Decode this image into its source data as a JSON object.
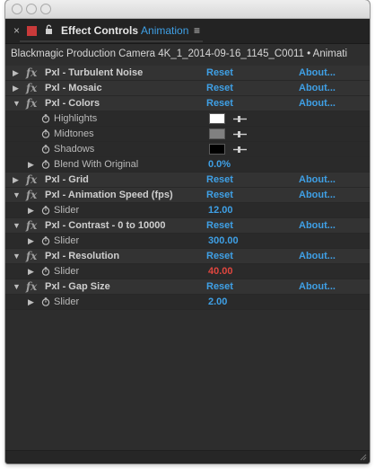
{
  "window": {
    "tab": {
      "close_glyph": "×",
      "label": "Effect Controls",
      "comp_name": "Animation",
      "menu_glyph": "≡",
      "swatch_color": "#c93a3a"
    },
    "clip_title": "Blackmagic Production Camera 4K_1_2014-09-16_1145_C0011 • Animati",
    "accent_color": "#3fa0e6",
    "error_color": "#e0463f"
  },
  "rows": [
    {
      "kind": "effect",
      "expanded": false,
      "name": "Pxl - Turbulent Noise",
      "reset": "Reset",
      "about": "About..."
    },
    {
      "kind": "effect",
      "expanded": false,
      "name": "Pxl - Mosaic",
      "reset": "Reset",
      "about": "About..."
    },
    {
      "kind": "effect",
      "expanded": true,
      "name": "Pxl - Colors",
      "reset": "Reset",
      "about": "About..."
    },
    {
      "kind": "color",
      "name": "Highlights",
      "color": "#ffffff"
    },
    {
      "kind": "color",
      "name": "Midtones",
      "color": "#808080"
    },
    {
      "kind": "color",
      "name": "Shadows",
      "color": "#000000"
    },
    {
      "kind": "param",
      "expanded": false,
      "name": "Blend With Original",
      "value": "0.0%",
      "red": false
    },
    {
      "kind": "effect",
      "expanded": false,
      "name": "Pxl - Grid",
      "reset": "Reset",
      "about": "About..."
    },
    {
      "kind": "effect",
      "expanded": true,
      "name": "Pxl - Animation Speed (fps)",
      "reset": "Reset",
      "about": "About..."
    },
    {
      "kind": "param",
      "expanded": false,
      "name": "Slider",
      "value": "12.00",
      "red": false
    },
    {
      "kind": "effect",
      "expanded": true,
      "name": "Pxl - Contrast - 0 to 10000",
      "reset": "Reset",
      "about": "About..."
    },
    {
      "kind": "param",
      "expanded": false,
      "name": "Slider",
      "value": "300.00",
      "red": false
    },
    {
      "kind": "effect",
      "expanded": true,
      "name": "Pxl - Resolution",
      "reset": "Reset",
      "about": "About..."
    },
    {
      "kind": "param",
      "expanded": false,
      "name": "Slider",
      "value": "40.00",
      "red": true
    },
    {
      "kind": "effect",
      "expanded": true,
      "name": "Pxl - Gap Size",
      "reset": "Reset",
      "about": "About..."
    },
    {
      "kind": "param",
      "expanded": false,
      "name": "Slider",
      "value": "2.00",
      "red": false
    }
  ],
  "icons": {
    "fx": "fx",
    "triangle_right": "▶",
    "triangle_down": "▼",
    "stopwatch": "stopwatch-icon",
    "eyedropper": "eyedropper-icon"
  }
}
